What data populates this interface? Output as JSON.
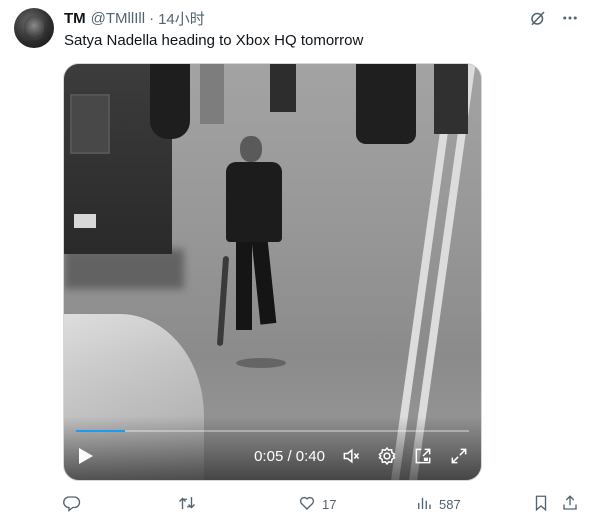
{
  "author": {
    "display_name": "TM",
    "handle": "@TMllIll",
    "separator": "·",
    "time": "14小时"
  },
  "tweet": {
    "text": "Satya Nadella heading to Xbox HQ tomorrow"
  },
  "video": {
    "timecode": "0:05 / 0:40",
    "progress": 0.125,
    "accent_color": "#1d9bf0"
  },
  "actions": {
    "reply_count": "",
    "retweet_count": "",
    "like_count": "17",
    "views_count": "587"
  },
  "icons": [
    "grok-icon",
    "more-icon",
    "play-icon",
    "mute-icon",
    "settings-icon",
    "picture-in-picture-icon",
    "fullscreen-icon",
    "reply-icon",
    "retweet-icon",
    "like-icon",
    "views-icon",
    "bookmark-icon",
    "share-icon"
  ],
  "colors": {
    "text_primary": "#0f1419",
    "text_secondary": "#536471",
    "border": "#cfd9de"
  }
}
